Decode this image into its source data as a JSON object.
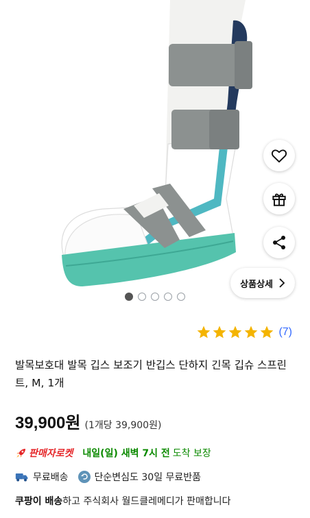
{
  "gallery": {
    "detail_button_label": "상품상세",
    "image_count": 5,
    "active_index": 0
  },
  "icons": [
    "heart-icon",
    "gift-icon",
    "share-icon",
    "chevron-right-icon",
    "star-icon",
    "rocket-icon",
    "truck-icon",
    "return-icon"
  ],
  "colors": {
    "star": "#f4b400",
    "link_blue": "#346aff",
    "rocket_red": "#e52528",
    "delivery_green": "#0b8a00",
    "boot_teal": "#55c3ad",
    "strap_gray": "#8c9190"
  },
  "rating": {
    "stars": 5,
    "count": "(7)"
  },
  "product": {
    "title": "발목보호대 발목 깁스 보조기 반깁스 단하지 긴목 깁슈 스프린트, M, 1개",
    "price": "39,900원",
    "unit_price": "(1개당 39,900원)"
  },
  "delivery": {
    "badge": "판매자로켓",
    "date": "내일(일) 새벽 7시 전",
    "suffix": "도착 보장",
    "free_shipping": "무료배송",
    "return_policy": "단순변심도 30일 무료반품"
  },
  "seller": {
    "strong": "쿠팡이 배송",
    "rest": "하고 주식회사 월드클레메디가 판매합니다"
  }
}
